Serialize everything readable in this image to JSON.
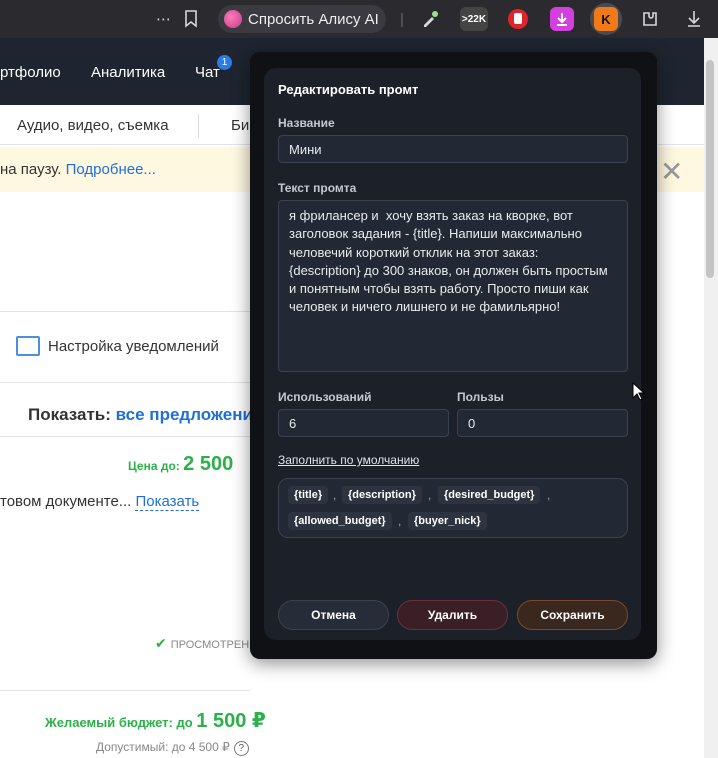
{
  "browser": {
    "alisa_label": "Спросить Алису AI",
    "ext_badge_22k": ">22K",
    "ext_active_letter": "K"
  },
  "site": {
    "nav": [
      "ртфолио",
      "Аналитика",
      "Чат"
    ],
    "chat_badge": "1",
    "categories": [
      "Аудио, видео, съемка",
      "Би"
    ],
    "notice_text": "на паузу.",
    "notice_link": "Подробнее...",
    "notify_label": "Настройка уведомлений",
    "show_label": "Показать:",
    "show_value": "все предложения",
    "price_prefix": "Цена до:",
    "price_value": "2 500",
    "doc_text": "товом документе...",
    "doc_link": "Показать",
    "viewed_label": "ПРОСМОТРЕН",
    "budget_prefix": "Желаемый бюджет: до",
    "budget_value": "1 500 ₽",
    "allowed_text": "Допустимый: до 4 500 ₽",
    "help_mark": "?"
  },
  "modal": {
    "title": "Редактировать промт",
    "name_label": "Название",
    "name_value": "Мини",
    "prompt_label": "Текст промта",
    "prompt_value": "я фрилансер и  хочу взять заказ на кворке, вот\nзаголовок задания - {title}. Напиши максимально\nчеловечий короткий отклик на этот заказ:\n{description} до 300 знаков, он должен быть простым\nи понятным чтобы взять работу. Просто пиши как\nчеловек и ничего лишнего и не фамильярно!",
    "uses_label": "Использований",
    "uses_value": "6",
    "benefit_label": "Пользы",
    "benefit_value": "0",
    "fill_default": "Заполнить по умолчанию",
    "variables": [
      "{title}",
      "{description}",
      "{desired_budget}",
      "{allowed_budget}",
      "{buyer_nick}"
    ],
    "separator": ",",
    "cancel": "Отмена",
    "delete": "Удалить",
    "save": "Сохранить"
  },
  "colors": {
    "accent_blue": "#1f6fd6",
    "price_green": "#2bb04a",
    "modal_bg": "#1b2029"
  }
}
